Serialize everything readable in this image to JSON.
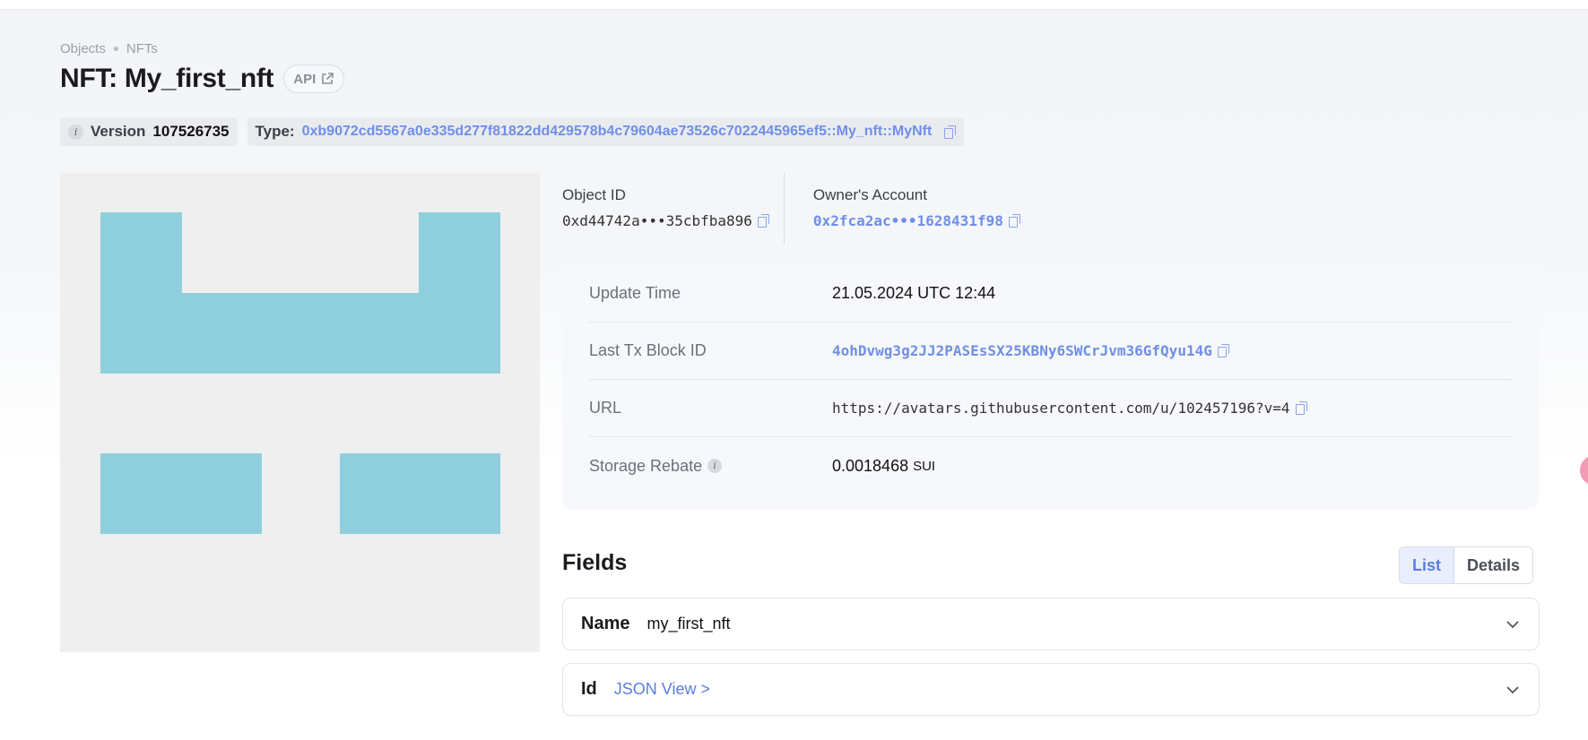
{
  "breadcrumb": {
    "items": [
      "Objects",
      "NFTs"
    ]
  },
  "header": {
    "title": "NFT: My_first_nft",
    "api_label": "API"
  },
  "chips": {
    "version_label": "Version",
    "version_value": "107526735",
    "type_label": "Type:",
    "type_value": "0xb9072cd5567a0e335d277f81822dd429578b4c79604ae73526c7022445965ef5::My_nft::MyNft"
  },
  "ids": {
    "object_id_label": "Object ID",
    "object_id_value": "0xd44742a•••35cbfba896",
    "owner_label": "Owner's Account",
    "owner_value": "0x2fca2ac•••1628431f98"
  },
  "details": {
    "update_time_label": "Update Time",
    "update_time_value": "21.05.2024 UTC 12:44",
    "last_tx_label": "Last Tx Block ID",
    "last_tx_value": "4ohDvwg3g2JJ2PASEsSX25KBNy6SWCrJvm36GfQyu14G",
    "url_label": "URL",
    "url_value": "https://avatars.githubusercontent.com/u/102457196?v=4",
    "storage_label": "Storage Rebate",
    "storage_value": "0.0018468",
    "storage_unit": "SUI"
  },
  "fields": {
    "title": "Fields",
    "toggle": {
      "list": "List",
      "details": "Details",
      "selected": "List"
    },
    "rows": [
      {
        "key": "Name",
        "value": "my_first_nft"
      },
      {
        "key": "Id",
        "value": "JSON View >"
      }
    ]
  },
  "colors": {
    "accent": "#6f8fe6",
    "nft_block": "#8fcfdd",
    "nft_background": "#efefef"
  }
}
